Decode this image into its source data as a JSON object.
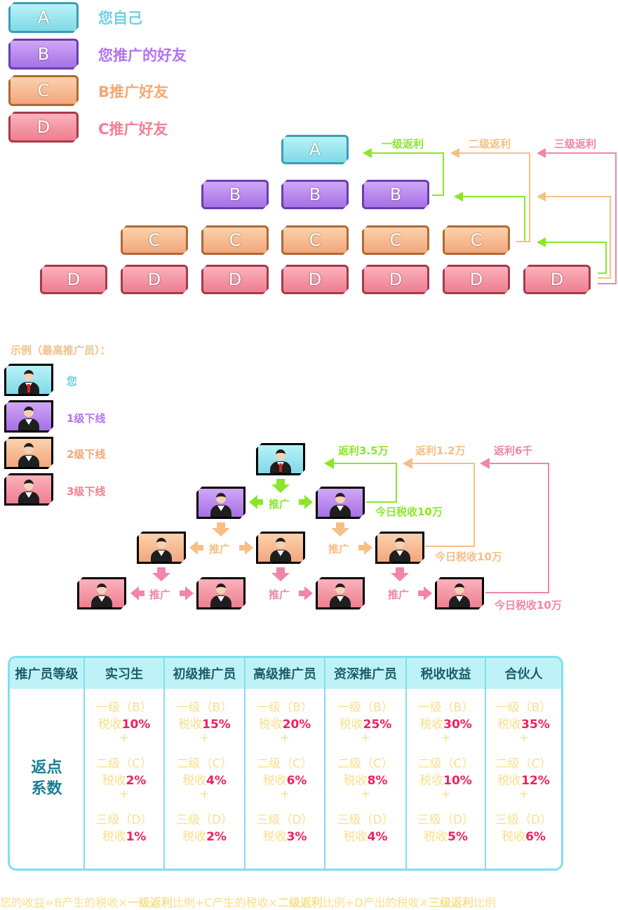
{
  "legend": [
    {
      "letter": "A",
      "text": "您自己"
    },
    {
      "letter": "B",
      "text": "您推广的好友"
    },
    {
      "letter": "C",
      "text": "B推广好友"
    },
    {
      "letter": "D",
      "text": "C推广好友"
    }
  ],
  "pyramid": {
    "a": "A",
    "b": "B",
    "c": "C",
    "d": "D",
    "labels": {
      "level1": "一级返利",
      "level2": "二级返利",
      "level3": "三级返利"
    }
  },
  "example": {
    "title": "示例（最高推广员）：",
    "legend": {
      "you": "您",
      "l1": "1级下线",
      "l2": "2级下线",
      "l3": "3级下线"
    },
    "promote": "推广",
    "rebates": {
      "r1": "返利3.5万",
      "r2": "返利1.2万",
      "r3": "返利6千"
    },
    "tax_today": "今日税收10万"
  },
  "table": {
    "headers": [
      "推广员等级",
      "实习生",
      "初级推广员",
      "高级推广员",
      "资深推广员",
      "税收收益",
      "合伙人"
    ],
    "row_label": [
      "返点",
      "系数"
    ],
    "line1": "一级（B）",
    "line2": "二级（C）",
    "line3": "三级（D）",
    "tax": "税收",
    "plus": "+",
    "columns": [
      {
        "l1": "10%",
        "l2": "2%",
        "l3": "1%"
      },
      {
        "l1": "15%",
        "l2": "4%",
        "l3": "2%"
      },
      {
        "l1": "20%",
        "l2": "6%",
        "l3": "3%"
      },
      {
        "l1": "25%",
        "l2": "8%",
        "l3": "4%"
      },
      {
        "l1": "30%",
        "l2": "10%",
        "l3": "5%"
      },
      {
        "l1": "35%",
        "l2": "12%",
        "l3": "6%"
      }
    ]
  },
  "formula": {
    "p1": "您的收益=B产生的税收×",
    "b1": "一级返利",
    "p2": "比例+C产生的税收×",
    "b2": "二级返利",
    "p3": "比例+D产出的税收×",
    "b3": "三级返利",
    "p4": "比例"
  },
  "colors": {
    "a": "#7fd9e6",
    "b": "#a670e6",
    "c": "#f3a67c",
    "d": "#ee7e8f",
    "green": "#8be62a",
    "orange": "#f6bf86",
    "pink": "#f286a6"
  }
}
